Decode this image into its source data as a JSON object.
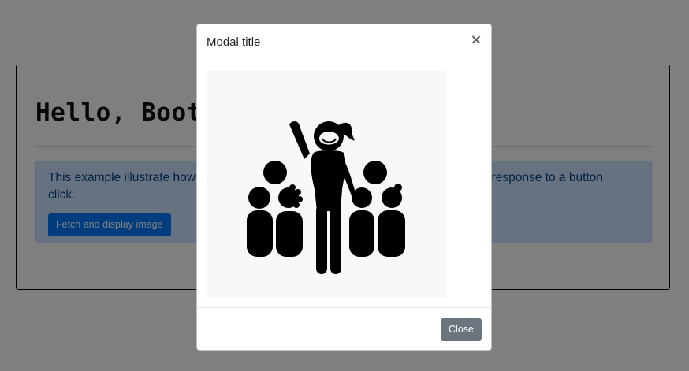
{
  "page": {
    "hero_title": "Hello, Bootstrap!",
    "alert_text": "This example illustrate how to use the modal component to display an image as a response to a button click.",
    "fetch_button_label": "Fetch and display image"
  },
  "modal": {
    "title": "Modal title",
    "close_icon_glyph": "×",
    "image_icon": "group-of-people-icon",
    "close_button_label": "Close"
  },
  "colors": {
    "primary": "#007bff",
    "secondary": "#6c757d",
    "alert_bg": "#cce5ff",
    "alert_text": "#004085",
    "backdrop": "rgba(0,0,0,0.5)"
  }
}
